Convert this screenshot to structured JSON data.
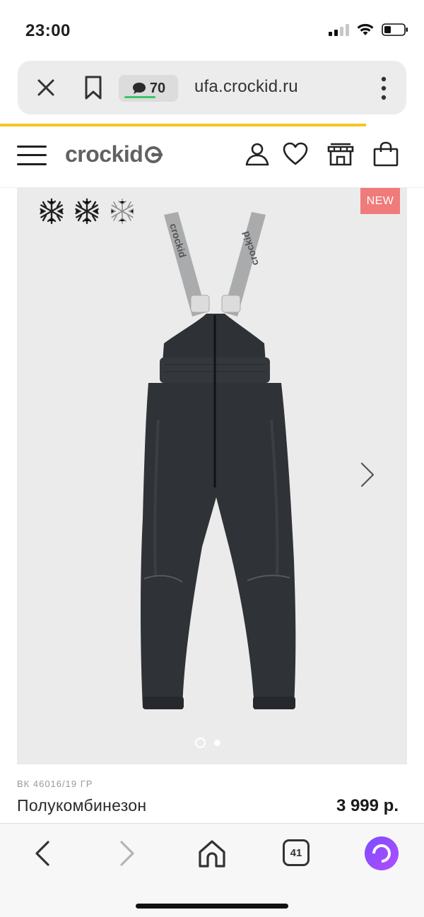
{
  "status_bar": {
    "time": "23:00",
    "icons": [
      "signal-icon",
      "wifi-icon",
      "battery-icon"
    ]
  },
  "url_bar": {
    "comments_count": "70",
    "url": "ufa.crockid.ru",
    "icons": [
      "close-icon",
      "bookmark-icon",
      "comment-bubble-icon",
      "more-vertical-icon"
    ],
    "page_load_progress": 0.86
  },
  "site_header": {
    "logo_text": "crockid",
    "logo_color": "#616161",
    "icons": [
      "menu-icon",
      "user-icon",
      "heart-icon",
      "store-icon",
      "shopping-bag-icon"
    ]
  },
  "product": {
    "badge": "NEW",
    "badge_color": "#ef7b7b",
    "season_icons": [
      "snowflake-icon",
      "snowflake-icon",
      "snowflake-outline-icon"
    ],
    "image_strap_text": "crockid",
    "slide_index": 1,
    "slide_count": 2,
    "sku": "ВК 46016/19 ГР",
    "name": "Полукомбинезон",
    "price": "3 999 р."
  },
  "bottom_bar": {
    "tabs_count": "41",
    "icons": [
      "back-arrow-icon",
      "forward-arrow-icon",
      "home-icon",
      "tabs-icon",
      "alice-assistant-icon"
    ],
    "alice_color": "#8a4dff"
  }
}
